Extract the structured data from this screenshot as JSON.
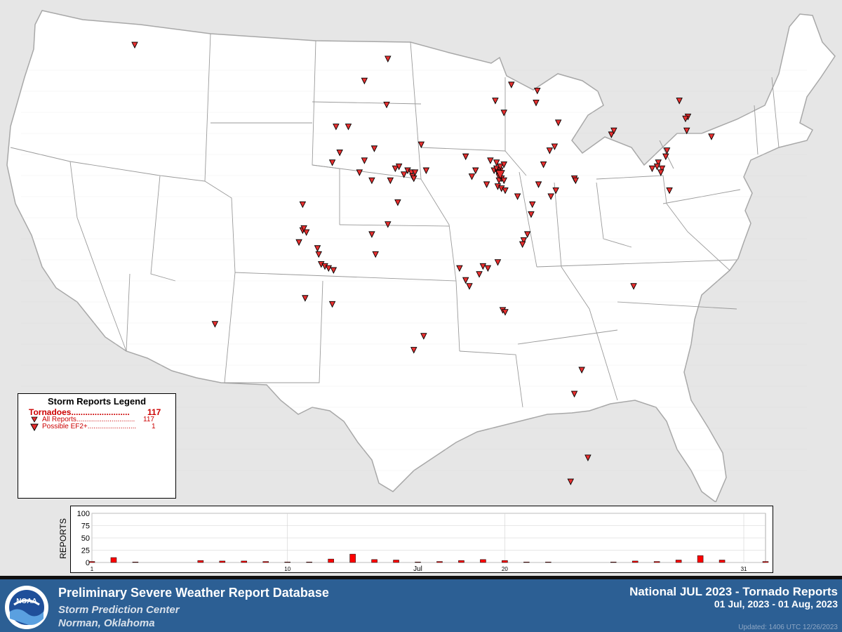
{
  "legend": {
    "title": "Storm Reports Legend",
    "tornado_label": "Tornadoes.........................",
    "tornado_total": "117",
    "all_reports_label": "All Reports..............................",
    "all_reports_count": "117",
    "ef2_label": "Possible EF2+.........................",
    "ef2_count": "1"
  },
  "chart": {
    "ylabel": "REPORTS",
    "yticks": [
      "100",
      "75",
      "50",
      "25",
      "0"
    ],
    "xticks": [
      "1",
      "10",
      "20",
      "31"
    ],
    "month": "Jul",
    "daily_counts": [
      2,
      10,
      1,
      0,
      0,
      4,
      3,
      3,
      2,
      1,
      1,
      7,
      17,
      6,
      5,
      1,
      2,
      4,
      6,
      4,
      1,
      1,
      0,
      0,
      1,
      3,
      2,
      5,
      14,
      5,
      0,
      2
    ],
    "colors": {
      "bar": "#ff0000",
      "marker": "#e83030"
    }
  },
  "footer": {
    "title": "Preliminary Severe Weather Report Database",
    "sub1": "Storm Prediction Center",
    "sub2": "Norman, Oklahoma",
    "right1": "National JUL 2023 - Tornado Reports",
    "right2": "01 Jul, 2023 - 01 Aug, 2023",
    "updated": "Updated: 1406 UTC 12/26/2023",
    "logo_text": "NOAA"
  },
  "map": {
    "reports": [
      {
        "lat": 48.2,
        "lon": -117.2
      },
      {
        "lat": 47.5,
        "lon": -96.7
      },
      {
        "lat": 46.4,
        "lon": -98.6
      },
      {
        "lat": 45.2,
        "lon": -96.8
      },
      {
        "lat": 44.1,
        "lon": -100.9
      },
      {
        "lat": 44.1,
        "lon": -99.9
      },
      {
        "lat": 42.8,
        "lon": -100.6
      },
      {
        "lat": 42.4,
        "lon": -98.6
      },
      {
        "lat": 43.0,
        "lon": -97.8
      },
      {
        "lat": 43.2,
        "lon": -94.0
      },
      {
        "lat": 42.0,
        "lon": -96.1
      },
      {
        "lat": 42.1,
        "lon": -95.8
      },
      {
        "lat": 41.7,
        "lon": -95.4
      },
      {
        "lat": 41.9,
        "lon": -95.1
      },
      {
        "lat": 41.8,
        "lon": -94.8
      },
      {
        "lat": 41.6,
        "lon": -94.7
      },
      {
        "lat": 41.5,
        "lon": -94.6
      },
      {
        "lat": 41.8,
        "lon": -94.5
      },
      {
        "lat": 41.9,
        "lon": -93.6
      },
      {
        "lat": 41.4,
        "lon": -96.5
      },
      {
        "lat": 41.4,
        "lon": -98.0
      },
      {
        "lat": 41.8,
        "lon": -99.0
      },
      {
        "lat": 42.3,
        "lon": -101.2
      },
      {
        "lat": 40.3,
        "lon": -95.9
      },
      {
        "lat": 39.2,
        "lon": -96.7
      },
      {
        "lat": 38.7,
        "lon": -98.0
      },
      {
        "lat": 37.7,
        "lon": -97.7
      },
      {
        "lat": 38.8,
        "lon": -103.3
      },
      {
        "lat": 38.9,
        "lon": -103.6
      },
      {
        "lat": 39.0,
        "lon": -103.5
      },
      {
        "lat": 38.3,
        "lon": -103.9
      },
      {
        "lat": 38.0,
        "lon": -102.4
      },
      {
        "lat": 37.7,
        "lon": -102.3
      },
      {
        "lat": 37.2,
        "lon": -102.1
      },
      {
        "lat": 37.1,
        "lon": -101.8
      },
      {
        "lat": 37.0,
        "lon": -101.5
      },
      {
        "lat": 36.9,
        "lon": -101.1
      },
      {
        "lat": 40.2,
        "lon": -103.6
      },
      {
        "lat": 35.5,
        "lon": -103.4
      },
      {
        "lat": 35.2,
        "lon": -101.2
      },
      {
        "lat": 34.2,
        "lon": -110.7
      },
      {
        "lat": 36.4,
        "lon": -90.4
      },
      {
        "lat": 37.0,
        "lon": -90.9
      },
      {
        "lat": 36.1,
        "lon": -90.1
      },
      {
        "lat": 34.9,
        "lon": -87.4
      },
      {
        "lat": 34.8,
        "lon": -87.2
      },
      {
        "lat": 33.6,
        "lon": -93.8
      },
      {
        "lat": 32.9,
        "lon": -94.6
      },
      {
        "lat": 42.4,
        "lon": -88.4
      },
      {
        "lat": 41.9,
        "lon": -89.6
      },
      {
        "lat": 41.6,
        "lon": -89.9
      },
      {
        "lat": 41.9,
        "lon": -88.1
      },
      {
        "lat": 42.0,
        "lon": -87.9
      },
      {
        "lat": 41.9,
        "lon": -87.6
      },
      {
        "lat": 41.8,
        "lon": -87.8
      },
      {
        "lat": 41.7,
        "lon": -87.6
      },
      {
        "lat": 41.6,
        "lon": -87.7
      },
      {
        "lat": 41.5,
        "lon": -87.5
      },
      {
        "lat": 41.4,
        "lon": -87.7
      },
      {
        "lat": 41.4,
        "lon": -87.3
      },
      {
        "lat": 41.1,
        "lon": -87.8
      },
      {
        "lat": 41.0,
        "lon": -87.5
      },
      {
        "lat": 40.9,
        "lon": -87.2
      },
      {
        "lat": 42.3,
        "lon": -87.9
      },
      {
        "lat": 42.1,
        "lon": -87.6
      },
      {
        "lat": 42.2,
        "lon": -87.3
      },
      {
        "lat": 40.6,
        "lon": -86.2
      },
      {
        "lat": 40.2,
        "lon": -85.0
      },
      {
        "lat": 41.2,
        "lon": -84.5
      },
      {
        "lat": 40.9,
        "lon": -83.1
      },
      {
        "lat": 40.6,
        "lon": -83.5
      },
      {
        "lat": 42.2,
        "lon": -84.1
      },
      {
        "lat": 42.9,
        "lon": -83.6
      },
      {
        "lat": 43.1,
        "lon": -83.2
      },
      {
        "lat": 44.3,
        "lon": -82.9
      },
      {
        "lat": 46.2,
        "lon": -86.7
      },
      {
        "lat": 41.5,
        "lon": -81.6
      },
      {
        "lat": 41.4,
        "lon": -81.5
      },
      {
        "lat": 39.7,
        "lon": -85.1
      },
      {
        "lat": 38.7,
        "lon": -85.4
      },
      {
        "lat": 38.4,
        "lon": -85.7
      },
      {
        "lat": 38.2,
        "lon": -85.8
      },
      {
        "lat": 37.3,
        "lon": -87.8
      },
      {
        "lat": 37.1,
        "lon": -89.0
      },
      {
        "lat": 37.0,
        "lon": -88.6
      },
      {
        "lat": 36.7,
        "lon": -89.3
      },
      {
        "lat": 42.0,
        "lon": -75.3
      },
      {
        "lat": 42.3,
        "lon": -74.8
      },
      {
        "lat": 42.1,
        "lon": -74.9
      },
      {
        "lat": 42.0,
        "lon": -74.5
      },
      {
        "lat": 41.8,
        "lon": -74.6
      },
      {
        "lat": 42.6,
        "lon": -74.2
      },
      {
        "lat": 42.9,
        "lon": -74.1
      },
      {
        "lat": 43.7,
        "lon": -78.6
      },
      {
        "lat": 43.9,
        "lon": -78.4
      },
      {
        "lat": 40.9,
        "lon": -73.9
      },
      {
        "lat": 45.4,
        "lon": -73.1
      },
      {
        "lat": 44.6,
        "lon": -72.4
      },
      {
        "lat": 44.5,
        "lon": -72.6
      },
      {
        "lat": 43.9,
        "lon": -72.5
      },
      {
        "lat": 43.6,
        "lon": -70.5
      },
      {
        "lat": 36.1,
        "lon": -76.8
      },
      {
        "lat": 31.9,
        "lon": -81.0
      },
      {
        "lat": 30.7,
        "lon": -81.6
      },
      {
        "lat": 27.5,
        "lon": -80.5
      },
      {
        "lat": 26.3,
        "lon": -81.9
      },
      {
        "lat": 44.8,
        "lon": -87.3
      },
      {
        "lat": 45.4,
        "lon": -88.0
      },
      {
        "lat": 45.3,
        "lon": -84.7
      },
      {
        "lat": 45.9,
        "lon": -84.6
      },
      {
        "lat": 42.6,
        "lon": -90.4
      },
      {
        "lat": 41.2,
        "lon": -88.7
      }
    ],
    "ef2_reports": [
      {
        "lat": 41.7,
        "lon": -87.6
      }
    ]
  }
}
